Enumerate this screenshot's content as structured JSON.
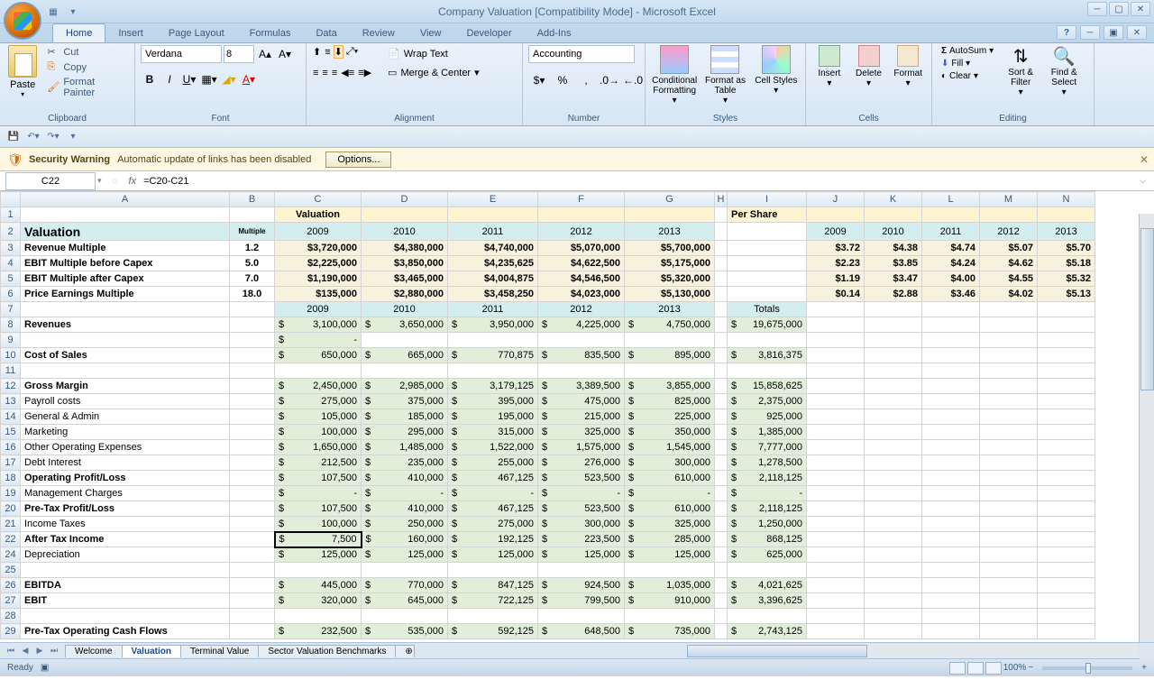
{
  "title": "Company Valuation  [Compatibility Mode] - Microsoft Excel",
  "tabs": [
    "Home",
    "Insert",
    "Page Layout",
    "Formulas",
    "Data",
    "Review",
    "View",
    "Developer",
    "Add-Ins"
  ],
  "activeTab": "Home",
  "clipboard": {
    "paste": "Paste",
    "cut": "Cut",
    "copy": "Copy",
    "fp": "Format Painter",
    "label": "Clipboard"
  },
  "font": {
    "name": "Verdana",
    "size": "8",
    "label": "Font"
  },
  "alignment": {
    "wrap": "Wrap Text",
    "merge": "Merge & Center",
    "label": "Alignment"
  },
  "number": {
    "format": "Accounting",
    "label": "Number"
  },
  "styles": {
    "cond": "Conditional Formatting",
    "table": "Format as Table",
    "cell": "Cell Styles",
    "label": "Styles"
  },
  "cells": {
    "insert": "Insert",
    "delete": "Delete",
    "format": "Format",
    "label": "Cells"
  },
  "editing": {
    "sum": "AutoSum",
    "fill": "Fill",
    "clear": "Clear",
    "sort": "Sort & Filter",
    "find": "Find & Select",
    "label": "Editing"
  },
  "security": {
    "title": "Security Warning",
    "text": "Automatic update of links has been disabled",
    "button": "Options..."
  },
  "nameBox": "C22",
  "formula": "=C20-C21",
  "cols": [
    "A",
    "B",
    "C",
    "D",
    "E",
    "F",
    "G",
    "H",
    "I",
    "J",
    "K",
    "L",
    "M",
    "N"
  ],
  "row1": {
    "C": "Valuation",
    "I": "Per Share"
  },
  "row2": {
    "A": "Valuation",
    "B": "Multiple",
    "C": "2009",
    "D": "2010",
    "E": "2011",
    "F": "2012",
    "G": "2013",
    "J": "2009",
    "K": "2010",
    "L": "2011",
    "M": "2012",
    "N": "2013"
  },
  "valuationRows": [
    {
      "label": "Revenue Multiple",
      "mult": "1.2",
      "vals": [
        "$3,720,000",
        "$4,380,000",
        "$4,740,000",
        "$5,070,000",
        "$5,700,000"
      ],
      "ps": [
        "$3.72",
        "$4.38",
        "$4.74",
        "$5.07",
        "$5.70"
      ]
    },
    {
      "label": "EBIT Multiple before Capex",
      "mult": "5.0",
      "vals": [
        "$2,225,000",
        "$3,850,000",
        "$4,235,625",
        "$4,622,500",
        "$5,175,000"
      ],
      "ps": [
        "$2.23",
        "$3.85",
        "$4.24",
        "$4.62",
        "$5.18"
      ]
    },
    {
      "label": "EBIT Multiple after Capex",
      "mult": "7.0",
      "vals": [
        "$1,190,000",
        "$3,465,000",
        "$4,004,875",
        "$4,546,500",
        "$5,320,000"
      ],
      "ps": [
        "$1.19",
        "$3.47",
        "$4.00",
        "$4.55",
        "$5.32"
      ]
    },
    {
      "label": "Price Earnings Multiple",
      "mult": "18.0",
      "vals": [
        "$135,000",
        "$2,880,000",
        "$3,458,250",
        "$4,023,000",
        "$5,130,000"
      ],
      "ps": [
        "$0.14",
        "$2.88",
        "$3.46",
        "$4.02",
        "$5.13"
      ]
    }
  ],
  "row7": {
    "C": "2009",
    "D": "2010",
    "E": "2011",
    "F": "2012",
    "G": "2013",
    "I": "Totals"
  },
  "financialRows": [
    {
      "r": 8,
      "label": "Revenues",
      "vals": [
        "3,100,000",
        "3,650,000",
        "3,950,000",
        "4,225,000",
        "4,750,000"
      ],
      "total": "19,675,000"
    },
    {
      "r": 9,
      "label": "",
      "vals": [
        "-",
        "",
        "",
        "",
        ""
      ],
      "total": ""
    },
    {
      "r": 10,
      "label": "Cost of Sales",
      "vals": [
        "650,000",
        "665,000",
        "770,875",
        "835,500",
        "895,000"
      ],
      "total": "3,816,375"
    },
    {
      "r": 11,
      "label": "",
      "vals": [
        "",
        "",
        "",
        "",
        ""
      ],
      "total": ""
    },
    {
      "r": 12,
      "label": "Gross Margin",
      "vals": [
        "2,450,000",
        "2,985,000",
        "3,179,125",
        "3,389,500",
        "3,855,000"
      ],
      "total": "15,858,625"
    },
    {
      "r": 13,
      "label": "Payroll costs",
      "vals": [
        "275,000",
        "375,000",
        "395,000",
        "475,000",
        "825,000"
      ],
      "total": "2,375,000"
    },
    {
      "r": 14,
      "label": "General & Admin",
      "vals": [
        "105,000",
        "185,000",
        "195,000",
        "215,000",
        "225,000"
      ],
      "total": "925,000"
    },
    {
      "r": 15,
      "label": "Marketing",
      "vals": [
        "100,000",
        "295,000",
        "315,000",
        "325,000",
        "350,000"
      ],
      "total": "1,385,000"
    },
    {
      "r": 16,
      "label": "Other Operating Expenses",
      "vals": [
        "1,650,000",
        "1,485,000",
        "1,522,000",
        "1,575,000",
        "1,545,000"
      ],
      "total": "7,777,000"
    },
    {
      "r": 17,
      "label": "Debt Interest",
      "vals": [
        "212,500",
        "235,000",
        "255,000",
        "276,000",
        "300,000"
      ],
      "total": "1,278,500"
    },
    {
      "r": 18,
      "label": "Operating Profit/Loss",
      "vals": [
        "107,500",
        "410,000",
        "467,125",
        "523,500",
        "610,000"
      ],
      "total": "2,118,125"
    },
    {
      "r": 19,
      "label": "Management Charges",
      "vals": [
        "-",
        "-",
        "-",
        "-",
        "-"
      ],
      "total": "-"
    },
    {
      "r": 20,
      "label": "Pre-Tax Profit/Loss",
      "vals": [
        "107,500",
        "410,000",
        "467,125",
        "523,500",
        "610,000"
      ],
      "total": "2,118,125"
    },
    {
      "r": 21,
      "label": "Income Taxes",
      "vals": [
        "100,000",
        "250,000",
        "275,000",
        "300,000",
        "325,000"
      ],
      "total": "1,250,000"
    },
    {
      "r": 22,
      "label": "After Tax Income",
      "vals": [
        "7,500",
        "160,000",
        "192,125",
        "223,500",
        "285,000"
      ],
      "total": "868,125"
    },
    {
      "r": 24,
      "label": "Depreciation",
      "vals": [
        "125,000",
        "125,000",
        "125,000",
        "125,000",
        "125,000"
      ],
      "total": "625,000"
    },
    {
      "r": 25,
      "label": "",
      "vals": [
        "",
        "",
        "",
        "",
        ""
      ],
      "total": ""
    },
    {
      "r": 26,
      "label": "EBITDA",
      "vals": [
        "445,000",
        "770,000",
        "847,125",
        "924,500",
        "1,035,000"
      ],
      "total": "4,021,625"
    },
    {
      "r": 27,
      "label": "EBIT",
      "vals": [
        "320,000",
        "645,000",
        "722,125",
        "799,500",
        "910,000"
      ],
      "total": "3,396,625"
    },
    {
      "r": 28,
      "label": "",
      "vals": [
        "",
        "",
        "",
        "",
        ""
      ],
      "total": ""
    },
    {
      "r": 29,
      "label": "Pre-Tax Operating Cash Flows",
      "vals": [
        "232,500",
        "535,000",
        "592,125",
        "648,500",
        "735,000"
      ],
      "total": "2,743,125"
    }
  ],
  "sheetTabs": [
    "Welcome",
    "Valuation",
    "Terminal Value",
    "Sector Valuation Benchmarks"
  ],
  "activeSheet": "Valuation",
  "status": "Ready",
  "zoom": "100%"
}
